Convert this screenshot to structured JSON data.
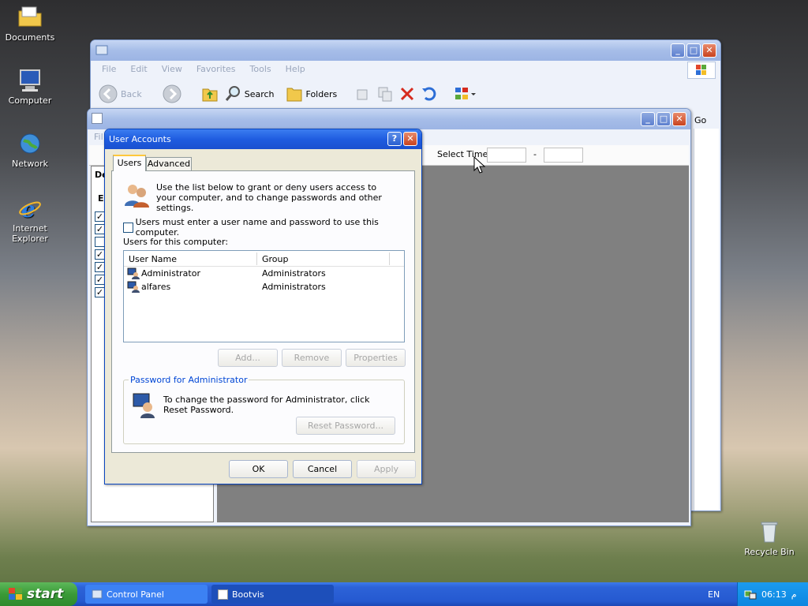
{
  "desktop": {
    "icons": [
      {
        "label": "Documents",
        "icon": "folder-icon"
      },
      {
        "label": "Computer",
        "icon": "computer-icon"
      },
      {
        "label": "Network",
        "icon": "network-icon"
      },
      {
        "label": "Internet Explorer",
        "icon": "ie-icon"
      },
      {
        "label": "Recycle Bin",
        "icon": "recycle-bin-icon"
      }
    ]
  },
  "cp_window": {
    "menu": [
      "File",
      "Edit",
      "View",
      "Favorites",
      "Tools",
      "Help"
    ],
    "toolbar": {
      "back": "Back",
      "search": "Search",
      "folders": "Folders"
    },
    "go": "Go"
  },
  "bootvis": {
    "title": "Bootvis",
    "menu_first": "Fil",
    "select_time": "Select Time",
    "dash": "-",
    "side_labels": [
      "De",
      "E"
    ],
    "checks": [
      true,
      true,
      false,
      true,
      true,
      true,
      true
    ]
  },
  "dialog": {
    "title": "User Accounts",
    "tabs": [
      "Users",
      "Advanced"
    ],
    "intro": "Use the list below to grant or deny users access to your computer, and to change passwords and other settings.",
    "must_login": "Users must enter a user name and password to use this computer.",
    "users_label": "Users for this computer:",
    "columns": [
      "User Name",
      "Group"
    ],
    "users": [
      {
        "name": "Administrator",
        "group": "Administrators"
      },
      {
        "name": "alfares",
        "group": "Administrators"
      }
    ],
    "buttons": {
      "add": "Add...",
      "remove": "Remove",
      "properties": "Properties",
      "reset": "Reset Password...",
      "ok": "OK",
      "cancel": "Cancel",
      "apply": "Apply"
    },
    "password_group": "Password for Administrator",
    "password_text": "To change the password for Administrator, click Reset Password."
  },
  "taskbar": {
    "start": "start",
    "items": [
      "Control Panel",
      "Bootvis"
    ],
    "lang": "EN",
    "time": "06:13",
    "ampm": "م"
  }
}
